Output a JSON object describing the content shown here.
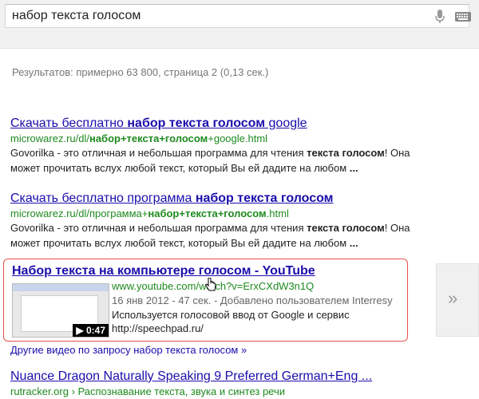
{
  "search": {
    "query": "набор текста голосом"
  },
  "stats_text": "Результатов: примерно 63 800, страница 2 (0,13 сек.)",
  "results": [
    {
      "title_plain": "Скачать бесплатно ",
      "title_bold": "набор текста голосом",
      "title_tail": " google",
      "url_plain": "microwarez.ru/dl/",
      "url_bold": "набор+текста+голосом",
      "url_tail": "+google.html",
      "snippet_1": "Govorilka - это отличная и небольшая программа для чтения ",
      "snippet_1_bold": "текста голосом",
      "snippet_1_tail": "! Она",
      "snippet_2": "может прочитать вслух любой текст, который Вы ей дадите на любом ",
      "snippet_2_bold": "..."
    },
    {
      "title_plain": "Скачать бесплатно программа ",
      "title_bold": "набор текста голосом",
      "title_tail": "",
      "url_plain": "microwarez.ru/dl/программа+",
      "url_bold": "набор+текста+голосом",
      "url_tail": ".html",
      "snippet_1": "Govorilka - это отличная и небольшая программа для чтения ",
      "snippet_1_bold": "текста голосом",
      "snippet_1_tail": "! Она",
      "snippet_2": "может прочитать вслух любой текст, который Вы ей дадите на любом ",
      "snippet_2_bold": "..."
    }
  ],
  "video": {
    "title": "Набор текста на компьютере голосом - YouTube",
    "url": "www.youtube.com/watch?v=ErxCXdW3n1Q",
    "meta": "16 янв 2012 - 47 сек. - Добавлено пользователем Interresy",
    "desc_1": "Используется голосовой ввод от Google и сервис",
    "desc_2": "http://speechpad.ru/",
    "duration": "▶ 0:47",
    "more_link": "Другие видео по запросу набор текста голосом »"
  },
  "last_result": {
    "title": "Nuance Dragon Naturally Speaking 9 Preferred German+Eng ...",
    "url": "rutracker.org",
    "breadcrumb": "› Распознавание текста, звука и синтез речи"
  },
  "colors": {
    "link": "#1a0dab",
    "url": "#1e8a1e",
    "highlight_border": "#e84f4f"
  },
  "icons": {
    "mic": "microphone-icon",
    "keyboard": "keyboard-icon",
    "next": "chevron-right-icon",
    "cursor": "hand-cursor-icon"
  }
}
